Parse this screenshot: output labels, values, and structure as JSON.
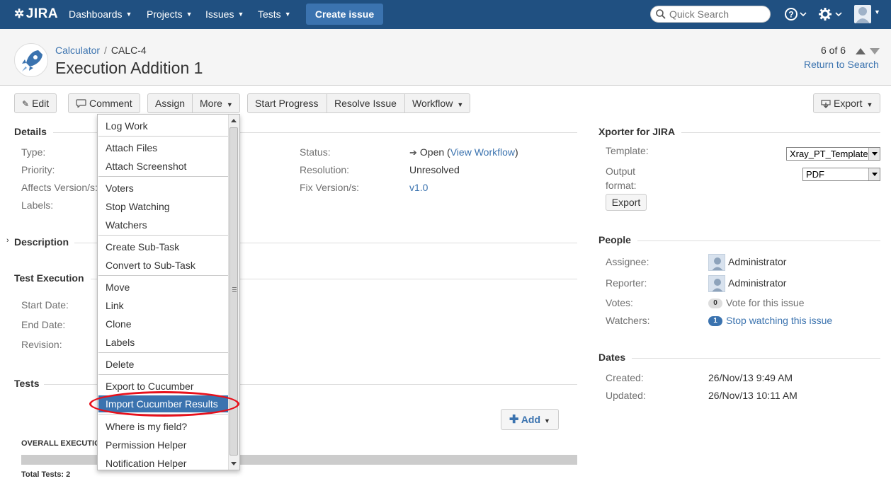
{
  "nav": {
    "logo": "JIRA",
    "items": [
      {
        "label": "Dashboards"
      },
      {
        "label": "Projects"
      },
      {
        "label": "Issues"
      },
      {
        "label": "Tests"
      }
    ],
    "create_label": "Create issue",
    "search_placeholder": "Quick Search",
    "brand_color": "#205081"
  },
  "header": {
    "project": "Calculator",
    "issue_key": "CALC-4",
    "title": "Execution Addition 1",
    "pager": "6 of 6",
    "return_link": "Return to Search"
  },
  "toolbar": {
    "edit": "Edit",
    "comment": "Comment",
    "assign": "Assign",
    "more": "More",
    "start_progress": "Start Progress",
    "resolve_issue": "Resolve Issue",
    "workflow": "Workflow",
    "export": "Export"
  },
  "details": {
    "heading": "Details",
    "type_label": "Type:",
    "priority_label": "Priority:",
    "affects_label": "Affects Version/s:",
    "labels_label": "Labels:",
    "status_label": "Status:",
    "status_value": "Open",
    "view_workflow": "View Workflow",
    "resolution_label": "Resolution:",
    "resolution_value": "Unresolved",
    "fix_label": "Fix Version/s:",
    "fix_value": "v1.0"
  },
  "description": {
    "heading": "Description"
  },
  "test_execution": {
    "heading": "Test Execution",
    "start_label": "Start Date:",
    "end_label": "End Date:",
    "revision_label": "Revision:"
  },
  "tests": {
    "heading": "Tests",
    "add_label": "Add",
    "overall_label": "OVERALL EXECUTIO",
    "total_label": "Total Tests: 2"
  },
  "xporter": {
    "heading": "Xporter for JIRA",
    "template_label": "Template:",
    "template_value": "Xray_PT_Template",
    "output_label_1": "Output",
    "output_label_2": "format:",
    "output_value": "PDF",
    "export_label": "Export"
  },
  "people": {
    "heading": "People",
    "assignee_label": "Assignee:",
    "assignee_value": "Administrator",
    "reporter_label": "Reporter:",
    "reporter_value": "Administrator",
    "votes_label": "Votes:",
    "votes_count": "0",
    "votes_link": "Vote for this issue",
    "watchers_label": "Watchers:",
    "watchers_count": "1",
    "watchers_link": "Stop watching this issue"
  },
  "dates": {
    "heading": "Dates",
    "created_label": "Created:",
    "created_value": "26/Nov/13 9:49 AM",
    "updated_label": "Updated:",
    "updated_value": "26/Nov/13 10:11 AM"
  },
  "menu": {
    "items": [
      "Log Work",
      "Attach Files",
      "Attach Screenshot",
      "Voters",
      "Stop Watching",
      "Watchers",
      "Create Sub-Task",
      "Convert to Sub-Task",
      "Move",
      "Link",
      "Clone",
      "Labels",
      "Delete",
      "Export to Cucumber",
      "Import Cucumber Results",
      "Where is my field?",
      "Permission Helper",
      "Notification Helper"
    ],
    "active_color": "#3b73af",
    "highlight_color": "#e8101b"
  }
}
